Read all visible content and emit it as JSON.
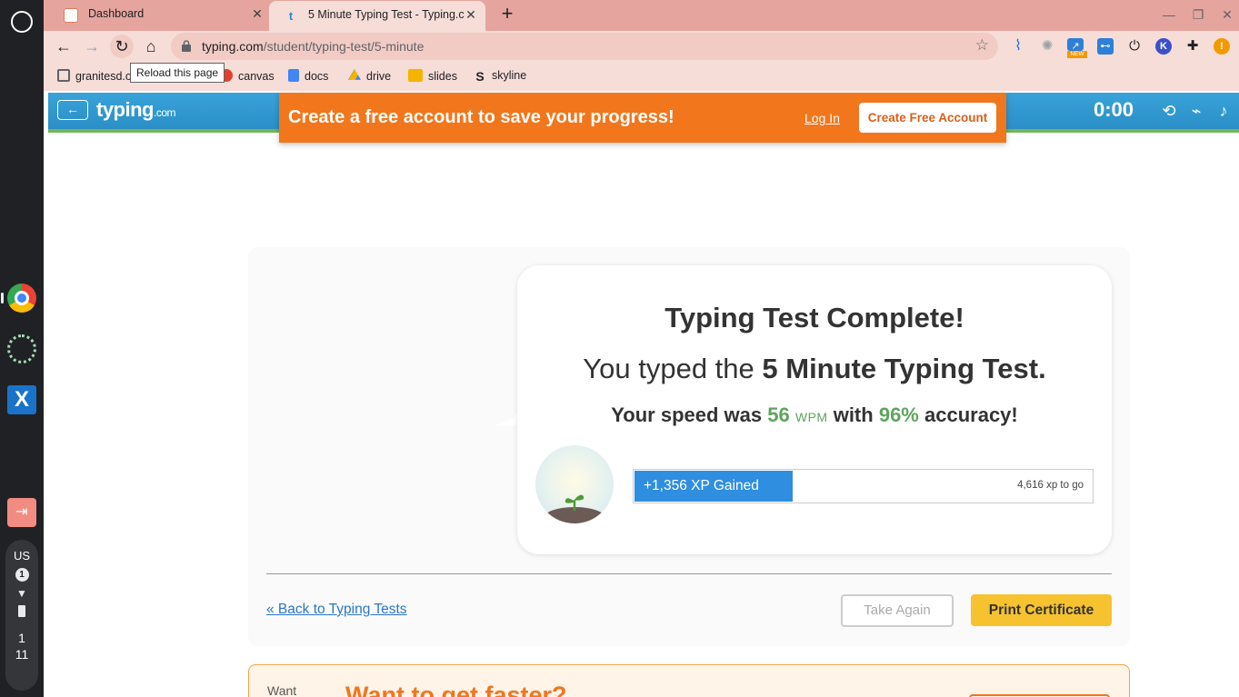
{
  "shelf": {
    "status": {
      "lang": "US",
      "notifications": "1",
      "time_hour": "1",
      "time_min": "11"
    }
  },
  "tabs": [
    {
      "title": "Dashboard",
      "active": false
    },
    {
      "title": "5 Minute Typing Test - Typing.com",
      "active": true
    }
  ],
  "toolbar": {
    "url_host": "typing.com",
    "url_path": "/student/typing-test/5-minute",
    "tooltip": "Reload this page",
    "ext_new_badge": "NEW",
    "ext_k": "K",
    "ext_alert": "!"
  },
  "bookmarks": [
    {
      "label": "granitesd.o",
      "icon": "folder-icon"
    },
    {
      "label": "canvas",
      "icon": "canvas-icon"
    },
    {
      "label": "docs",
      "icon": "docs-icon"
    },
    {
      "label": "drive",
      "icon": "drive-icon"
    },
    {
      "label": "slides",
      "icon": "slides-icon"
    },
    {
      "label": "skyline",
      "icon": "skyline-icon"
    }
  ],
  "site": {
    "logo_main": "typing",
    "logo_suffix": ".com",
    "timer": "0:00",
    "back_icon": "arrow-left-icon"
  },
  "promo": {
    "message": "Create a free account to save your progress!",
    "login": "Log In",
    "create": "Create Free Account"
  },
  "results": {
    "title": "Typing Test Complete!",
    "typed_prefix": "You typed the",
    "typed_test": "5 Minute Typing Test.",
    "speed_prefix": "Your speed was",
    "wpm": "56",
    "wpm_unit": "WPM",
    "speed_mid": "with",
    "accuracy": "96%",
    "speed_suffix": "accuracy!",
    "xp_gained": "+1,356 XP Gained",
    "xp_to_go": "4,616 xp to go",
    "xp_progress": 0.345
  },
  "actions": {
    "back_link": "« Back to Typing Tests",
    "take_again": "Take Again",
    "print_certificate": "Print Certificate"
  },
  "faster": {
    "img_alt": "Want",
    "title": "Want to get faster?"
  },
  "colors": {
    "tabstrip": "#e5a59e",
    "toolbar": "#f6ddd8",
    "header_blue": "#2a8fc7",
    "promo_orange": "#f2761c",
    "accent_green": "#5da55d",
    "xp_blue": "#2f8ee0",
    "print_yellow": "#f6c22f"
  }
}
